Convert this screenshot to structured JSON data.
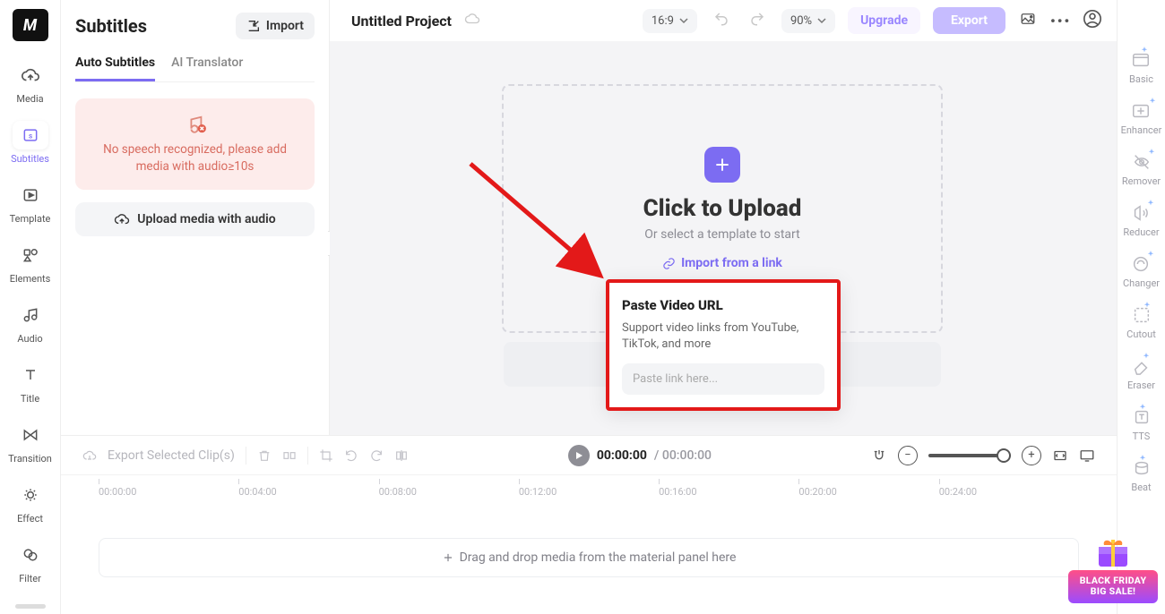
{
  "sidebar": {
    "items": [
      {
        "label": "Media"
      },
      {
        "label": "Subtitles"
      },
      {
        "label": "Template"
      },
      {
        "label": "Elements"
      },
      {
        "label": "Audio"
      },
      {
        "label": "Title"
      },
      {
        "label": "Transition"
      },
      {
        "label": "Effect"
      },
      {
        "label": "Filter"
      }
    ]
  },
  "panel": {
    "title": "Subtitles",
    "import_label": "Import",
    "tabs": [
      {
        "label": "Auto Subtitles"
      },
      {
        "label": "AI Translator"
      }
    ],
    "alert_msg": "No speech recognized, please add media with audio≥10s",
    "upload_label": "Upload media with audio"
  },
  "topbar": {
    "project_title": "Untitled Project",
    "ratio": "16:9",
    "zoom": "90%",
    "upgrade": "Upgrade",
    "export": "Export"
  },
  "drop": {
    "heading": "Click to Upload",
    "sub": "Or select a template to start",
    "import_link": "Import from a link"
  },
  "popover": {
    "title": "Paste Video URL",
    "desc": "Support video links from YouTube, TikTok, and more",
    "placeholder": "Paste link here..."
  },
  "timeline": {
    "export_clip": "Export Selected Clip(s)",
    "current": "00:00:00",
    "total": "00:00:00",
    "ticks": [
      "00:00:00",
      "00:04:00",
      "00:08:00",
      "00:12:00",
      "00:16:00",
      "00:20:00",
      "00:24:00"
    ],
    "track_hint": "Drag and drop media from the material panel here"
  },
  "rrail": {
    "items": [
      {
        "label": "Basic"
      },
      {
        "label": "Enhancer"
      },
      {
        "label": "Remover"
      },
      {
        "label": "Reducer"
      },
      {
        "label": "Changer"
      },
      {
        "label": "Cutout"
      },
      {
        "label": "Eraser"
      },
      {
        "label": "TTS"
      },
      {
        "label": "Beat"
      }
    ]
  },
  "promo": {
    "line1": "BLACK FRIDAY",
    "line2": "BIG SALE!"
  }
}
